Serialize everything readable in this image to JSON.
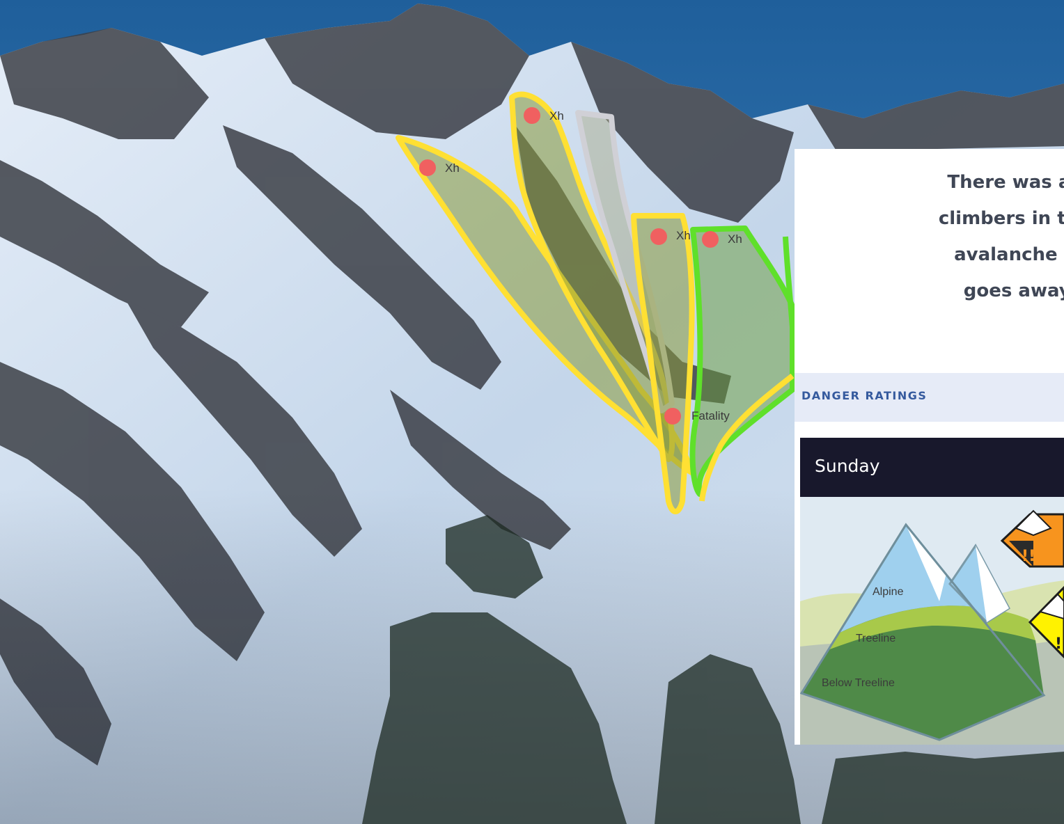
{
  "photo": {
    "labels": {
      "crown_1": "Xh",
      "crown_2": "Xh",
      "crown_3": "Xh",
      "crown_4": "Xh",
      "fatality": "Fatality"
    },
    "colors": {
      "sky": "#2f6fa8",
      "snow": "#dbe7f3",
      "rock": "#3a3d44",
      "yellow_outline": "#ffe033",
      "green_outline": "#5fe02a",
      "grey_outline": "#d0d0d6",
      "marker": "#f06060"
    }
  },
  "notice": {
    "lines": [
      "There was a serious av",
      "climbers in the Ranger C",
      "avalanche terrain unt",
      "goes away. The Ran"
    ]
  },
  "danger": {
    "section_title": "DANGER RATINGS",
    "day": "Sunday",
    "bands": {
      "alpine": "Alpine",
      "treeline": "Treeline",
      "below_treeline": "Below Treeline"
    },
    "icons": [
      "considerable-danger-icon",
      "moderate-danger-icon"
    ],
    "colors": {
      "header": "#18182c",
      "considerable": "#f7941e",
      "moderate": "#fff200",
      "title_text": "#355a9e",
      "bar": "#e6ebf7"
    }
  }
}
